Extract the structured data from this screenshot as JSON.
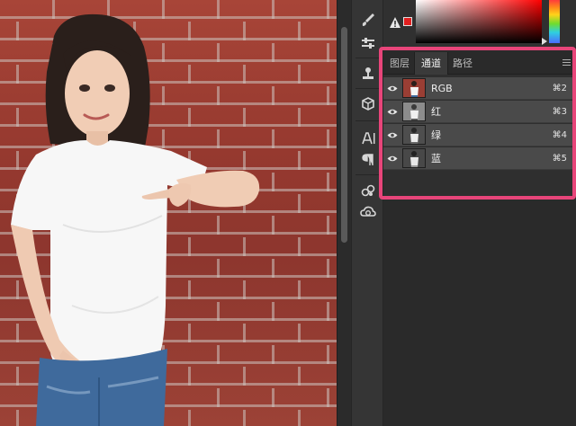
{
  "panel": {
    "tabs": [
      {
        "label": "图层",
        "active": false
      },
      {
        "label": "通道",
        "active": true
      },
      {
        "label": "路径",
        "active": false
      }
    ],
    "channels": [
      {
        "name": "RGB",
        "shortcut": "⌘2",
        "thumb": "color"
      },
      {
        "name": "红",
        "shortcut": "⌘3",
        "thumb": "gray"
      },
      {
        "name": "绿",
        "shortcut": "⌘4",
        "thumb": "gray"
      },
      {
        "name": "蓝",
        "shortcut": "⌘5",
        "thumb": "gray"
      }
    ]
  },
  "colors": {
    "foreground_swatch": "#e11f1f",
    "highlight_border": "#e8457a"
  },
  "tools": [
    "brush-settings-icon",
    "adjustments-icon",
    "clone-source-icon",
    "3d-icon",
    "character-icon",
    "paragraph-icon",
    "libraries-icon",
    "creative-cloud-icon"
  ]
}
